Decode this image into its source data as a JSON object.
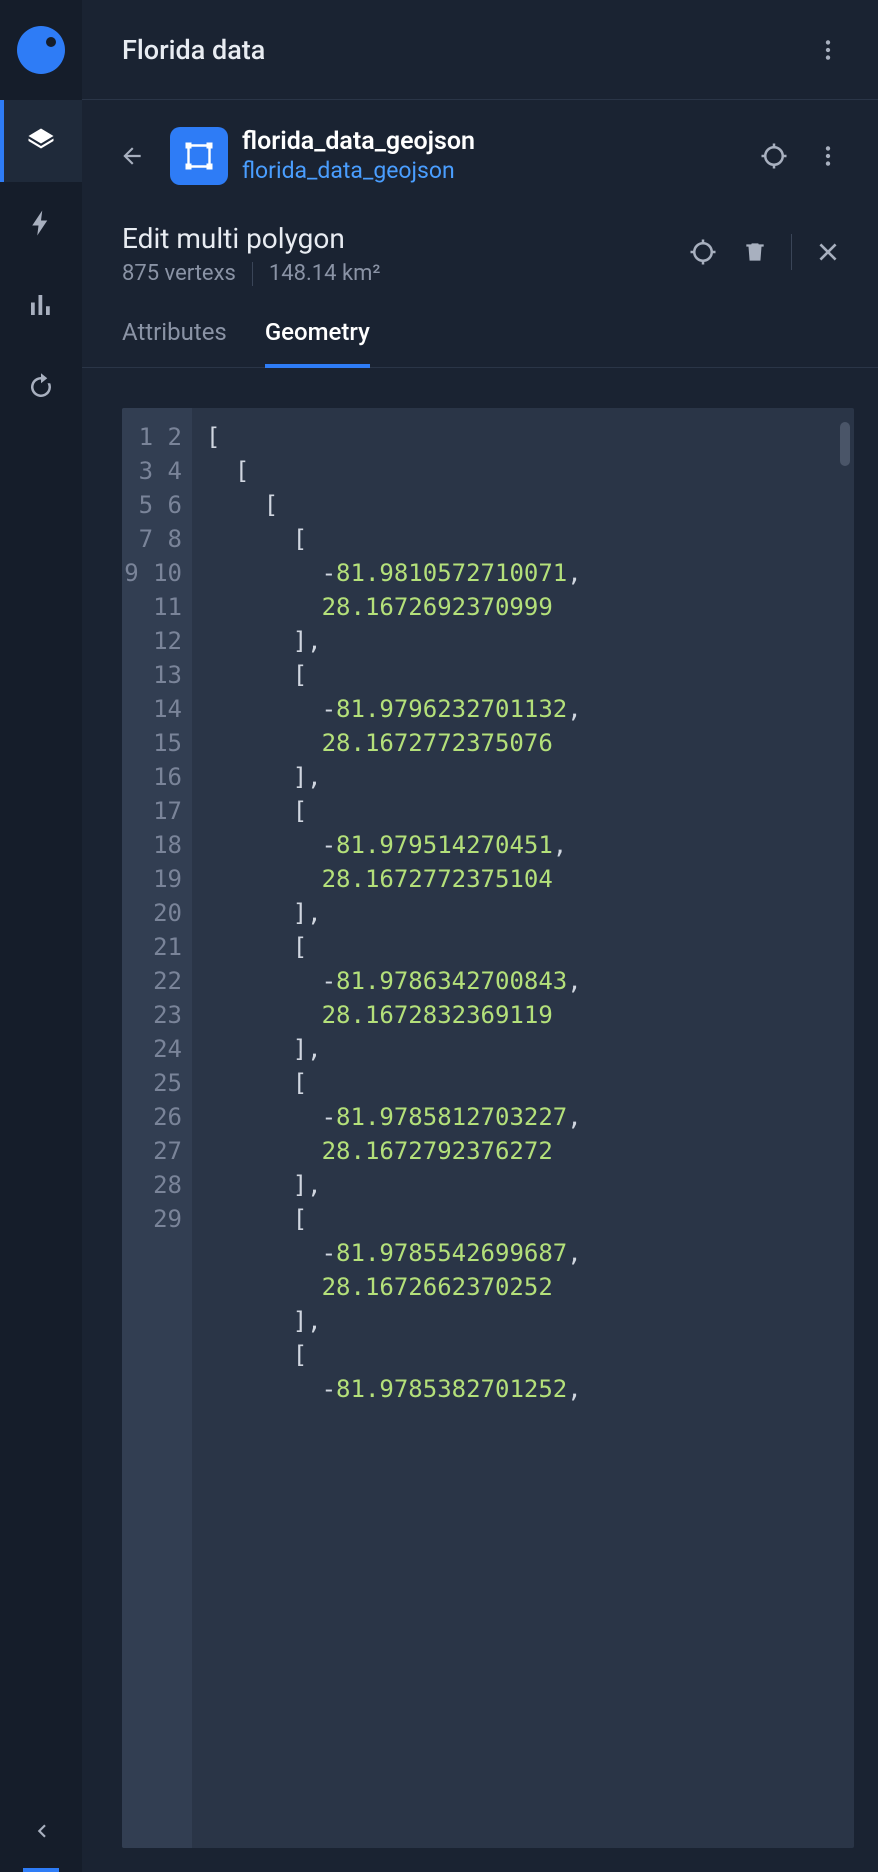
{
  "header": {
    "title": "Florida data"
  },
  "layer": {
    "name": "florida_data_geojson",
    "subtitle": "florida_data_geojson"
  },
  "edit": {
    "title": "Edit multi polygon",
    "vertex_count": "875 vertexs",
    "area": "148.14 km²"
  },
  "tabs": {
    "attributes": "Attributes",
    "geometry": "Geometry"
  },
  "code": {
    "line_count": 29,
    "coords": [
      [
        -81.9810572710071,
        28.1672692370999
      ],
      [
        -81.9796232701132,
        28.1672772375076
      ],
      [
        -81.979514270451,
        28.1672772375104
      ],
      [
        -81.9786342700843,
        28.1672832369119
      ],
      [
        -81.9785812703227,
        28.1672792376272
      ],
      [
        -81.9785542699687,
        28.1672662370252
      ]
    ],
    "trailing_lon": "-81.9785382701252"
  }
}
